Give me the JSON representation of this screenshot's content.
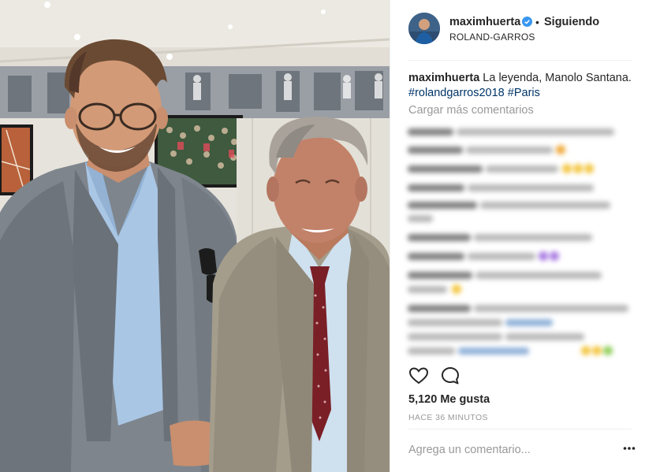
{
  "post": {
    "username": "maximhuerta",
    "follow_status": "Siguiendo",
    "separator": "•",
    "location": "ROLAND-GARROS",
    "caption_username": "maximhuerta",
    "caption_text": "La leyenda, Manolo Santana.",
    "hashtags": [
      "#rolandgarros2018",
      "#Paris"
    ],
    "load_more_comments": "Cargar más comentarios",
    "likes": "5,120 Me gusta",
    "timestamp": "HACE 36 MINUTOS",
    "comment_placeholder": "Agrega un comentario..."
  },
  "icons": {
    "verified": "verified-badge-icon",
    "like": "heart-icon",
    "comment": "comment-bubble-icon",
    "options": "more-options-icon"
  },
  "colors": {
    "verified_badge": "#3897f0",
    "hashtag": "#003569",
    "muted_text": "#999999",
    "primary_text": "#262626"
  }
}
